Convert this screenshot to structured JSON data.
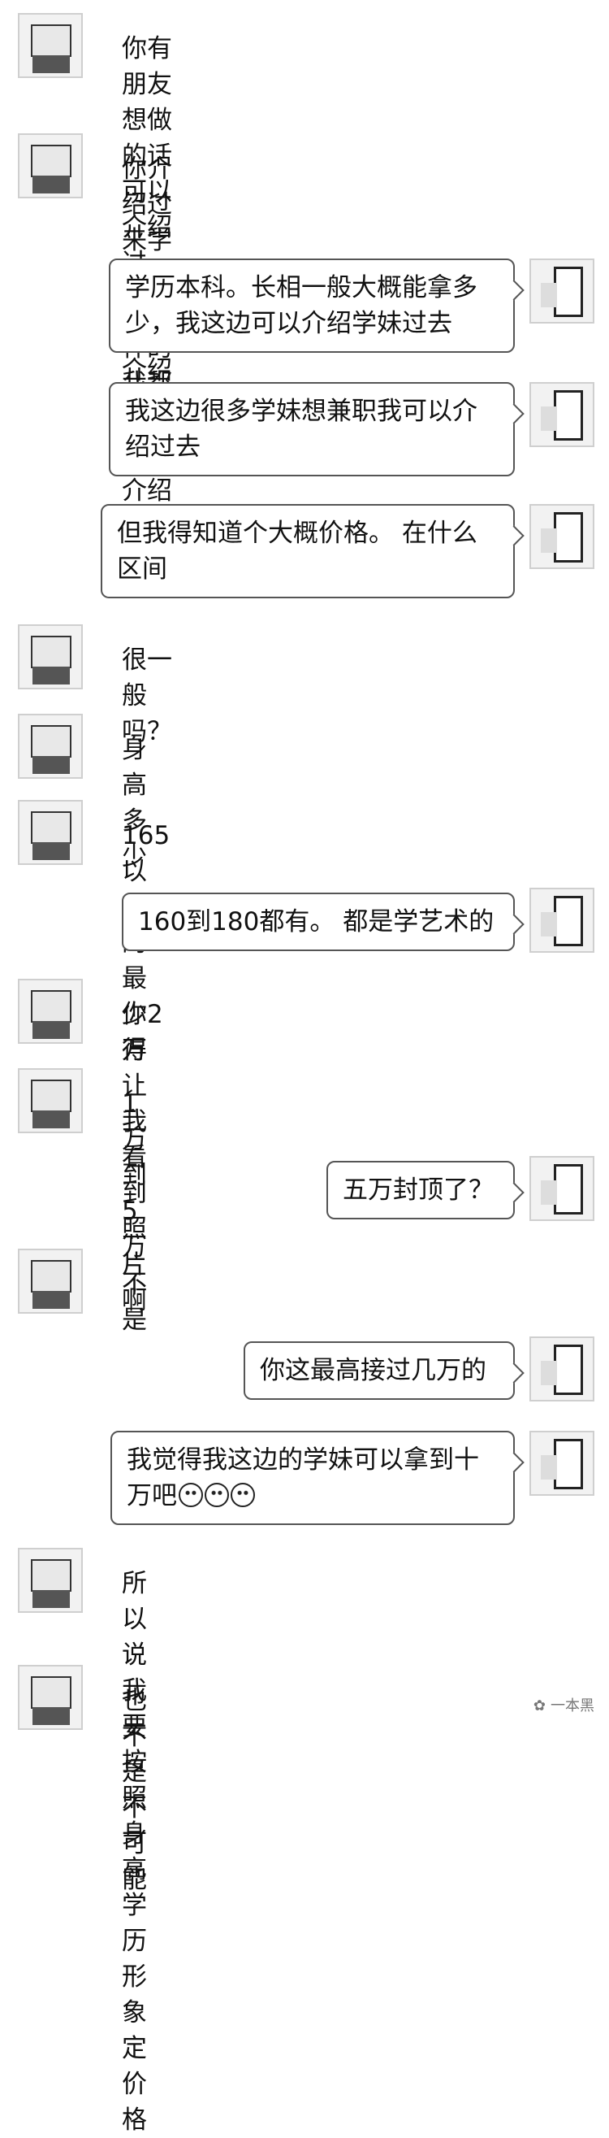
{
  "messages": [
    {
      "side": "left",
      "text": "你有朋友想做的话可以介绍过\n来，给你介绍费"
    },
    {
      "side": "left",
      "text": "你介绍过来学历跟你一样的我都\n给你5000介绍费"
    },
    {
      "side": "right",
      "text": "学历本科。长相一般大概能拿多\n少，我这边可以介绍学妹过去"
    },
    {
      "side": "right",
      "text": "我这边很多学妹想兼职我可以介\n绍过去"
    },
    {
      "side": "right",
      "text": "但我得知道个大概价格。 在什么\n区间"
    },
    {
      "side": "left",
      "text": "很一般吗？"
    },
    {
      "side": "left",
      "text": "身高多少"
    },
    {
      "side": "left",
      "text": "165以上的最少2万"
    },
    {
      "side": "right",
      "text": "160到180都有。 都是学艺术的"
    },
    {
      "side": "left",
      "text": "你得让我看到照片啊"
    },
    {
      "side": "left",
      "text": "1万到5万"
    },
    {
      "side": "right",
      "text": "五万封顶了？"
    },
    {
      "side": "left",
      "text": "不是"
    },
    {
      "side": "right",
      "text": "你这最高接过几万的"
    },
    {
      "side": "right",
      "text": "我觉得我这边的学妹可以拿到十\n万吧",
      "emojis": [
        "😅",
        "😅",
        "😅"
      ]
    },
    {
      "side": "left",
      "text": "所以说我要按照身高学历形象定\n价格"
    },
    {
      "side": "left",
      "text": "也不是不可能"
    }
  ],
  "watermark": {
    "icon": "wechat-icon",
    "text": "一本黑"
  }
}
